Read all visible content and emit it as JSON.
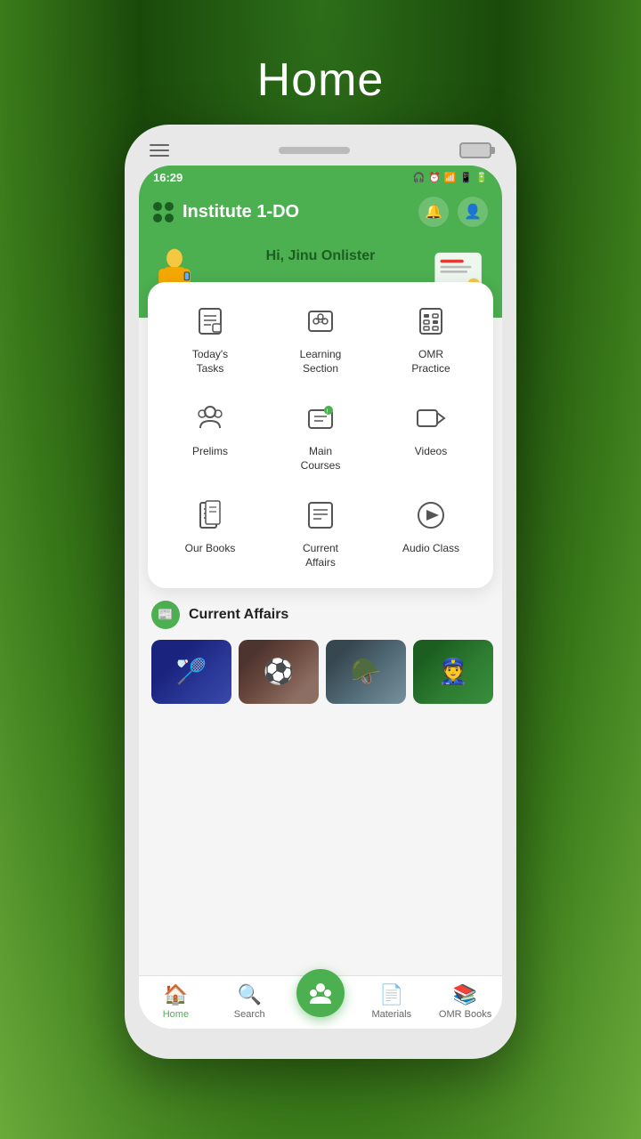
{
  "page": {
    "title": "Home",
    "background": "#2d6e1a"
  },
  "status_bar": {
    "time": "16:29",
    "icons": "🎧 ⏰ 📶 📱 🔋"
  },
  "header": {
    "app_name": "Institute 1-DO",
    "bell_icon": "🔔",
    "user_icon": "👤"
  },
  "banner": {
    "greeting": "Hi, Jinu Onlister"
  },
  "menu": {
    "items": [
      {
        "id": "todays-tasks",
        "label": "Today's\nTasks",
        "icon": "📋"
      },
      {
        "id": "learning-section",
        "label": "Learning\nSection",
        "icon": "📚"
      },
      {
        "id": "omr-practice",
        "label": "OMR\nPractice",
        "icon": "📝"
      },
      {
        "id": "prelims",
        "label": "Prelims",
        "icon": "🎓"
      },
      {
        "id": "main-courses",
        "label": "Main\nCourses",
        "icon": "💬"
      },
      {
        "id": "videos",
        "label": "Videos",
        "icon": "🎥"
      },
      {
        "id": "our-books",
        "label": "Our Books",
        "icon": "📖"
      },
      {
        "id": "current-affairs",
        "label": "Current\nAffairs",
        "icon": "📰"
      },
      {
        "id": "audio-class",
        "label": "Audio Class",
        "icon": "▶"
      }
    ]
  },
  "current_affairs": {
    "section_title": "Current Affairs",
    "news_items": [
      {
        "id": "news-1",
        "emoji": "🏸"
      },
      {
        "id": "news-2",
        "emoji": "⚽"
      },
      {
        "id": "news-3",
        "emoji": "🪖"
      },
      {
        "id": "news-4",
        "emoji": "👮"
      }
    ]
  },
  "bottom_nav": {
    "items": [
      {
        "id": "home",
        "label": "Home",
        "icon": "🏠",
        "active": true
      },
      {
        "id": "search",
        "label": "Search",
        "icon": "🔍",
        "active": false
      },
      {
        "id": "center",
        "label": "",
        "icon": "👥",
        "active": false
      },
      {
        "id": "materials",
        "label": "Materials",
        "icon": "📄",
        "active": false
      },
      {
        "id": "omr-books",
        "label": "OMR Books",
        "icon": "📚",
        "active": false
      }
    ]
  }
}
